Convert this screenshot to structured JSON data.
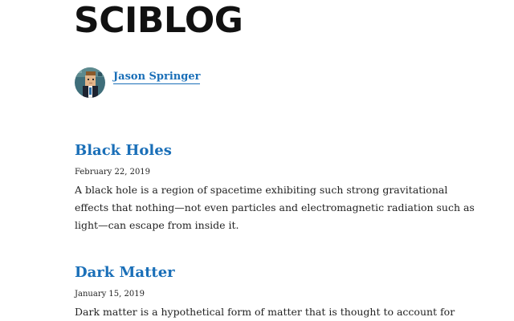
{
  "site": {
    "title": "SCIBLOG"
  },
  "author": {
    "name": "Jason Springer",
    "avatar_icon": "pixel-avatar-icon"
  },
  "colors": {
    "link": "#1a6fb8",
    "text": "#222222",
    "title": "#111111"
  },
  "posts": [
    {
      "title": "Black Holes",
      "date": "February 22, 2019",
      "excerpt": "A black hole is a region of spacetime exhibiting such strong gravitational effects that nothing—not even particles and electromagnetic radiation such as light—can escape from inside it."
    },
    {
      "title": "Dark Matter",
      "date": "January 15, 2019",
      "excerpt": "Dark matter is a hypothetical form of matter that is thought to account for"
    }
  ]
}
